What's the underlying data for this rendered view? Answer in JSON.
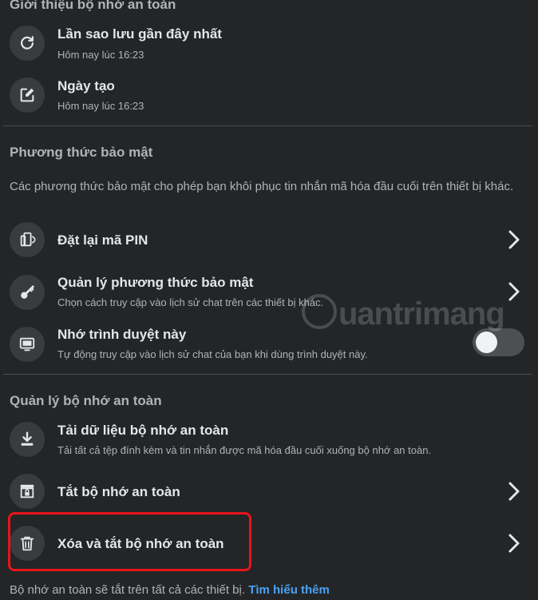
{
  "section_intro": {
    "title": "Giới thiệu bộ nhớ an toàn",
    "items": [
      {
        "title": "Lần sao lưu gần đây nhất",
        "subtitle": "Hôm nay lúc 16:23",
        "icon": "refresh-icon"
      },
      {
        "title": "Ngày tạo",
        "subtitle": "Hôm nay lúc 16:23",
        "icon": "edit-icon"
      }
    ]
  },
  "section_security": {
    "title": "Phương thức bảo mật",
    "description": "Các phương thức bảo mật cho phép bạn khôi phục tin nhắn mã hóa đầu cuối trên thiết bị khác.",
    "items": [
      {
        "title": "Đặt lại mã PIN",
        "icon": "devices-icon"
      },
      {
        "title": "Quản lý phương thức bảo mật",
        "subtitle": "Chọn cách truy cập vào lịch sử chat trên các thiết bị khác.",
        "icon": "key-icon"
      },
      {
        "title": "Nhớ trình duyệt này",
        "subtitle": "Tự động truy cập vào lịch sử chat của bạn khi dùng trình duyệt này.",
        "icon": "monitor-icon",
        "toggle_on": false
      }
    ]
  },
  "section_manage": {
    "title": "Quản lý bộ nhớ an toàn",
    "items": [
      {
        "title": "Tải dữ liệu bộ nhớ an toàn",
        "subtitle": "Tải tất cả tệp đính kèm và tin nhắn được mã hóa đầu cuối xuống bộ nhớ an toàn.",
        "icon": "download-icon"
      },
      {
        "title": "Tắt bộ nhớ an toàn",
        "icon": "storage-lock-icon"
      },
      {
        "title": "Xóa và tắt bộ nhớ an toàn",
        "icon": "trash-icon"
      }
    ]
  },
  "footer": {
    "text": "Bộ nhớ an toàn sẽ tắt trên tất cả các thiết bị.",
    "link": "Tìm hiểu thêm"
  },
  "watermark": "uantrimang",
  "colors": {
    "background": "#242526",
    "icon_bg": "#3a3b3c",
    "highlight": "#e8141b",
    "link": "#4aa3f5"
  }
}
